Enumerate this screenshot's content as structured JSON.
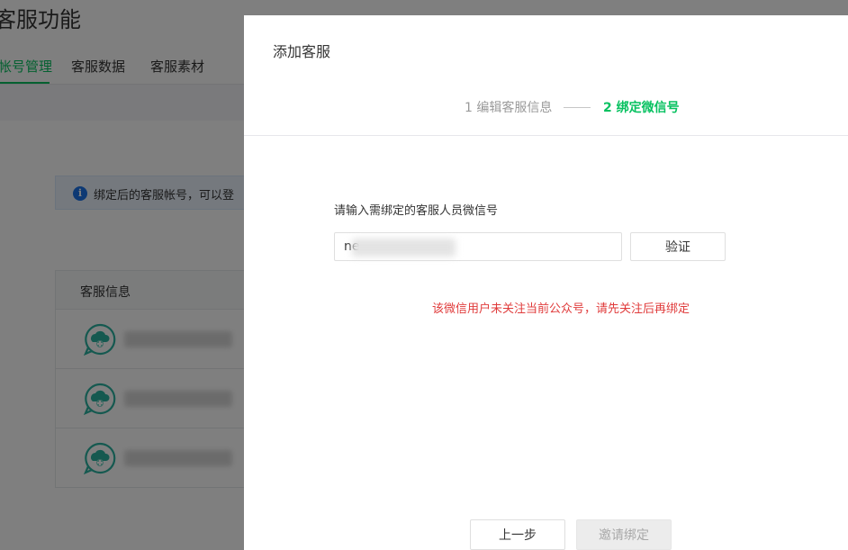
{
  "background": {
    "page_title": "客服功能",
    "tabs": [
      {
        "label": "帐号管理",
        "active": true
      },
      {
        "label": "客服数据",
        "active": false
      },
      {
        "label": "客服素材",
        "active": false
      }
    ],
    "tip_text": "绑定后的客服帐号，可以登",
    "table_header": "客服信息",
    "accent_color": "#07c160"
  },
  "dialog": {
    "title": "添加客服",
    "steps": {
      "step1": "1 编辑客服信息",
      "step2": "2 绑定微信号"
    },
    "field_label": "请输入需绑定的客服人员微信号",
    "input_value": "ne",
    "verify_label": "验证",
    "error_message": "该微信用户未关注当前公众号，请先关注后再绑定",
    "prev_label": "上一步",
    "invite_label": "邀请绑定",
    "error_color": "#e03c3c"
  }
}
